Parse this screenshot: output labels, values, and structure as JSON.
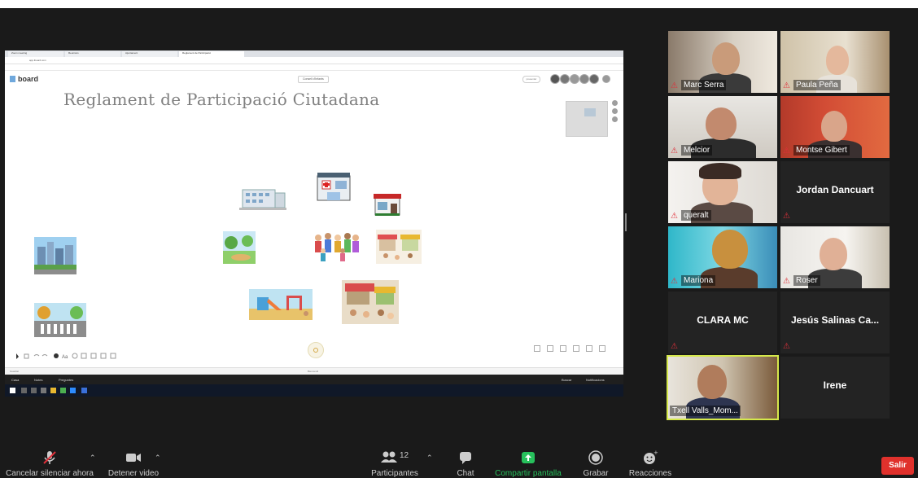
{
  "shared_screen": {
    "browser_tabs": [
      "Zoom meeting",
      "Reunions",
      "Ajuntament",
      "Reglament de Participació"
    ],
    "address": "app.iboard.com",
    "board": {
      "logo": "board",
      "center_button": "Consell d'Infants",
      "right_button": "presentar",
      "title": "Reglament de Participació Ciutadana",
      "status_center": "Bienvenid",
      "status_left": "Guardat"
    },
    "taskbar": {
      "items": [
        "Casa",
        "Notes",
        "Preguntes"
      ],
      "search": "Buscar",
      "notifications": "Notificacions"
    }
  },
  "participants": [
    {
      "name": "Marc Serra",
      "muted": true,
      "video": true
    },
    {
      "name": "Paula Peña",
      "muted": true,
      "video": true
    },
    {
      "name": "Melcior",
      "muted": true,
      "video": true
    },
    {
      "name": "Montse Gibert",
      "muted": true,
      "video": true
    },
    {
      "name": "queralt",
      "muted": true,
      "video": true
    },
    {
      "name": "Jordan Dancuart",
      "muted": true,
      "video": false
    },
    {
      "name": "Mariona",
      "muted": true,
      "video": true
    },
    {
      "name": "Roser",
      "muted": true,
      "video": true
    },
    {
      "name": "CLARA MC",
      "muted": true,
      "video": false
    },
    {
      "name": "Jesús Salinas Ca...",
      "muted": true,
      "video": false
    },
    {
      "name": "Txell Valls_Mom...",
      "muted": false,
      "video": true,
      "active": true
    },
    {
      "name": "Irene",
      "muted": false,
      "video": false
    }
  ],
  "controls": {
    "unmute": "Cancelar silenciar ahora",
    "video": "Detener video",
    "participants": "Participantes",
    "participants_count": "12",
    "chat": "Chat",
    "share": "Compartir pantalla",
    "record": "Grabar",
    "reactions": "Reacciones",
    "leave": "Salir"
  },
  "colors": {
    "background": "#1a1a1a",
    "share_green": "#27c05c",
    "leave_red": "#e0312c",
    "active_speaker": "#d5e84b",
    "muted_red": "#e0303a"
  }
}
